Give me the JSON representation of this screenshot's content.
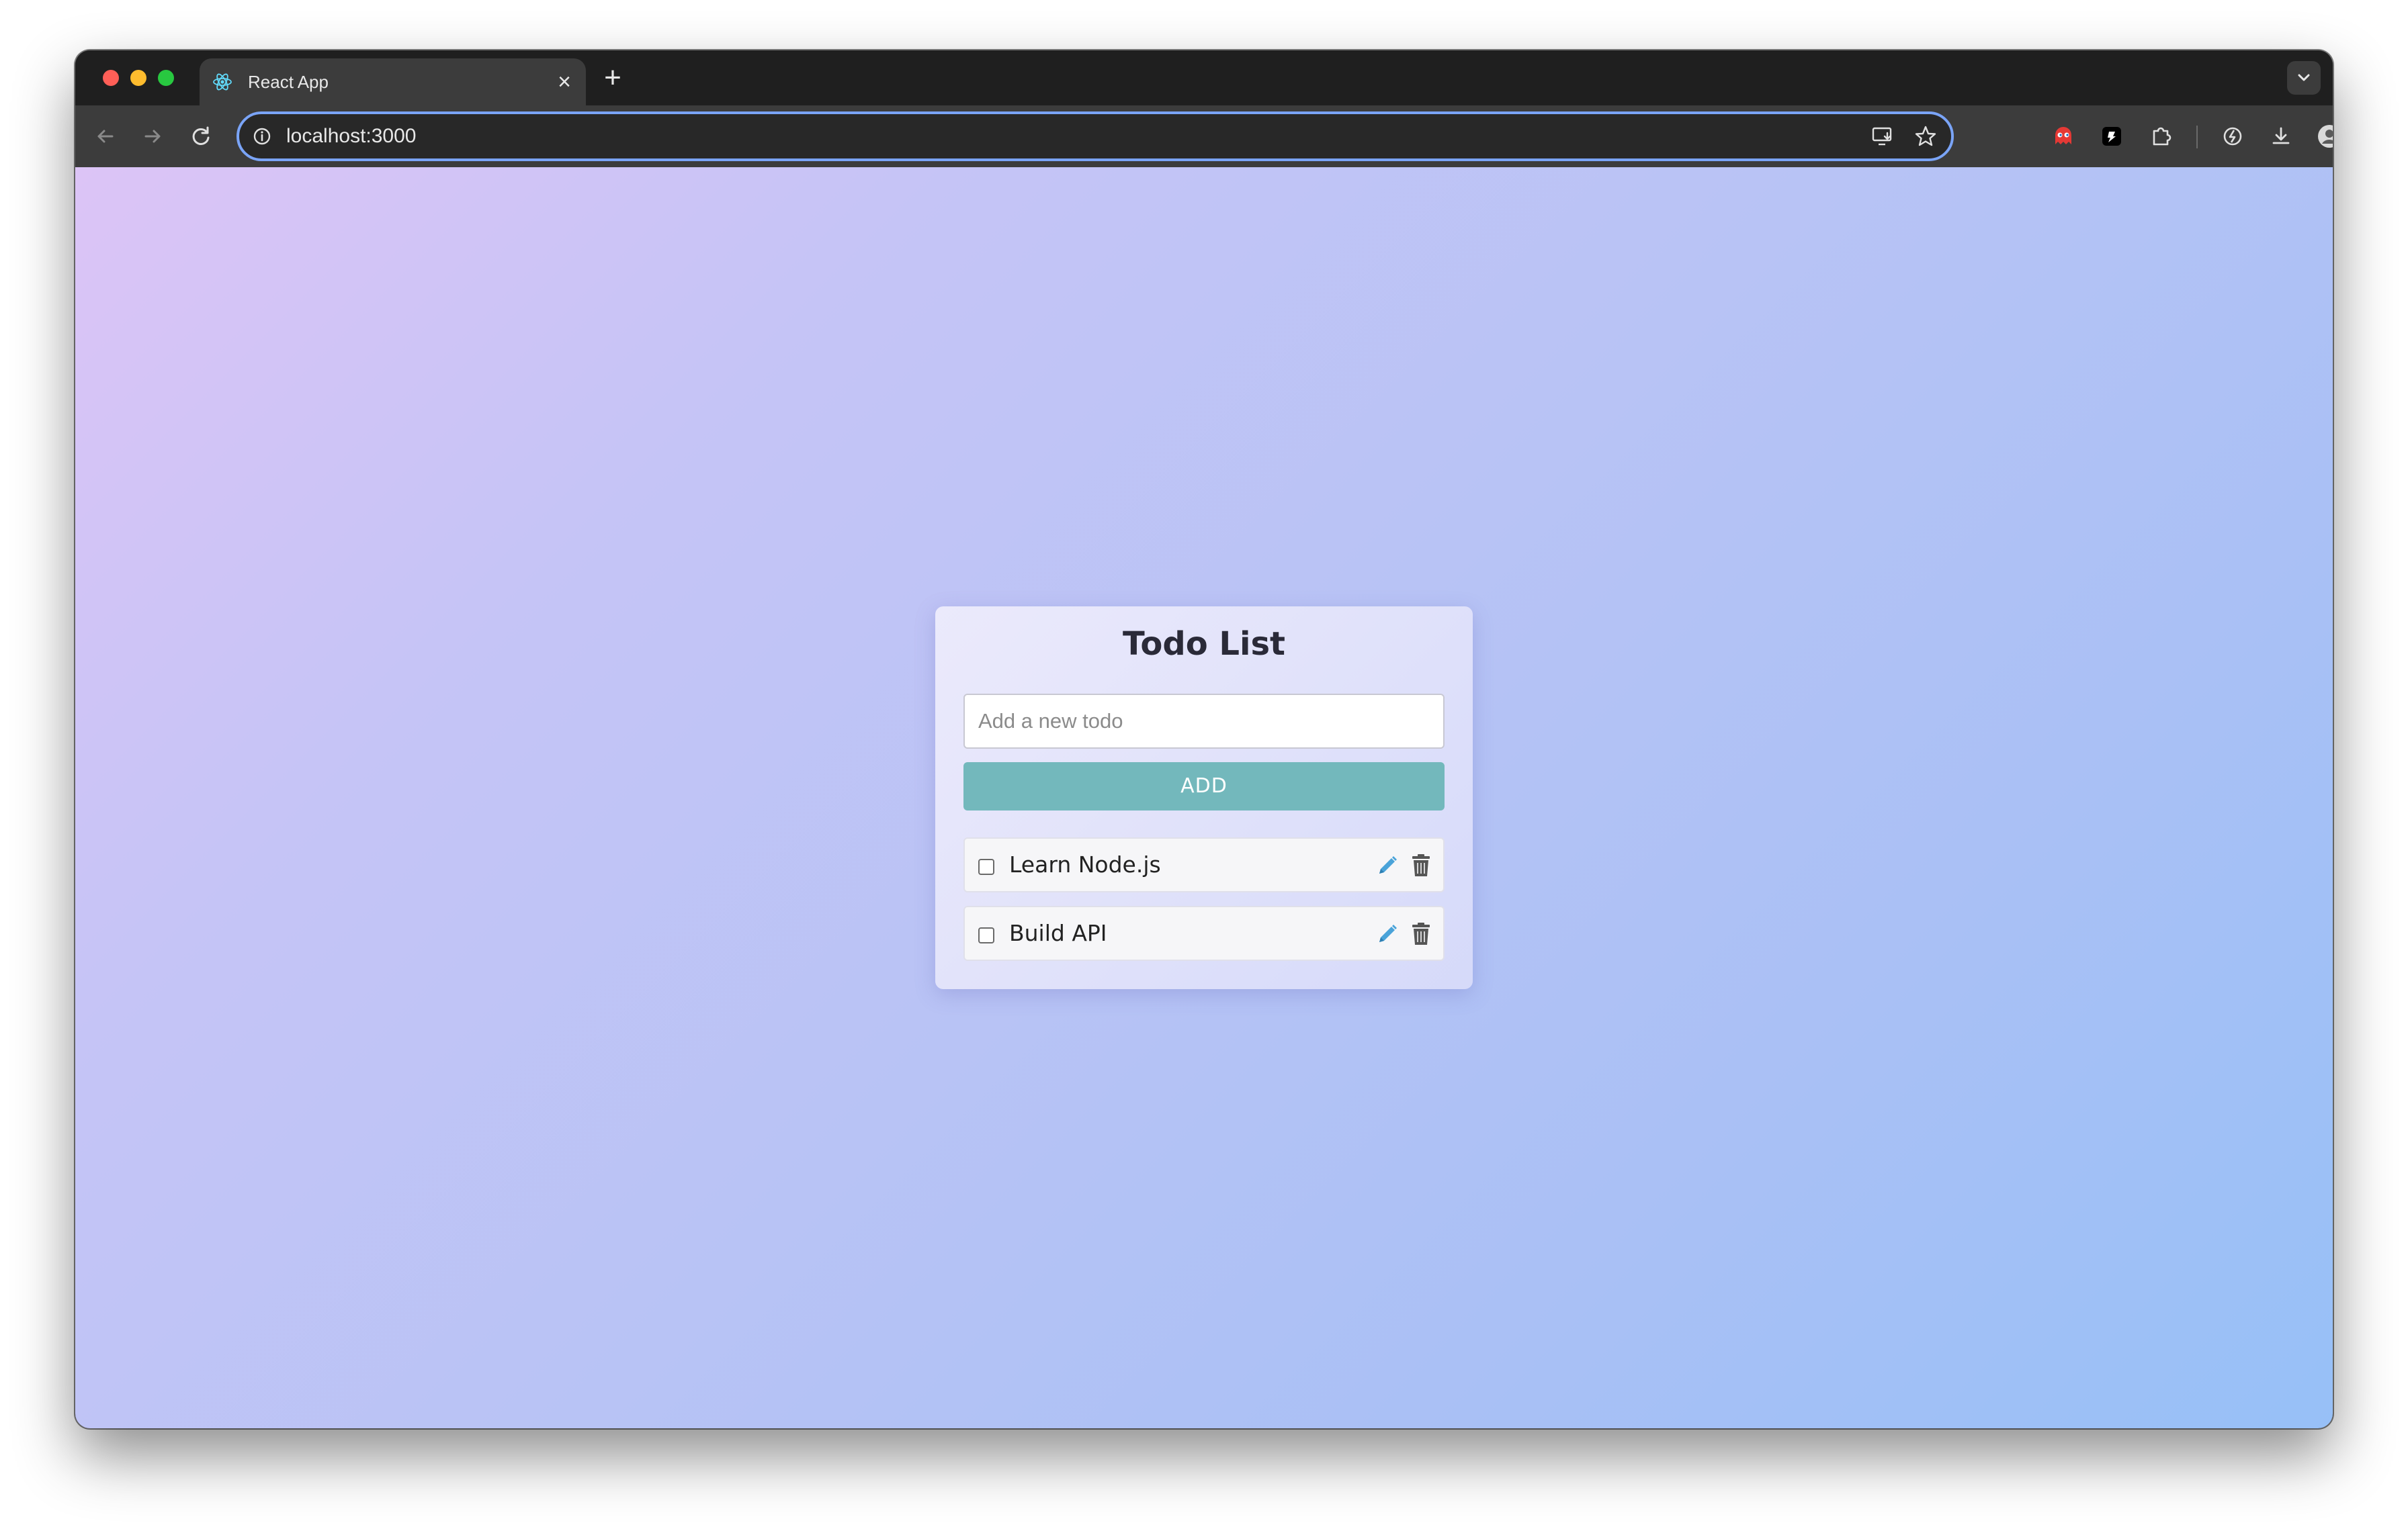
{
  "browser": {
    "tab_title": "React App",
    "tab_close": "×",
    "new_tab": "+",
    "url": "localhost:3000"
  },
  "app": {
    "title": "Todo List",
    "input_placeholder": "Add a new todo",
    "input_value": "",
    "add_label": "ADD",
    "todos": [
      {
        "text": "Learn Node.js",
        "completed": false
      },
      {
        "text": "Build API",
        "completed": false
      }
    ]
  },
  "colors": {
    "accent": "#73b8bc",
    "edit_icon": "#4aa3d9",
    "delete_icon": "#555555"
  },
  "icons": {
    "favicon": "react-logo-icon",
    "edit": "pencil-icon",
    "delete": "trash-icon"
  }
}
